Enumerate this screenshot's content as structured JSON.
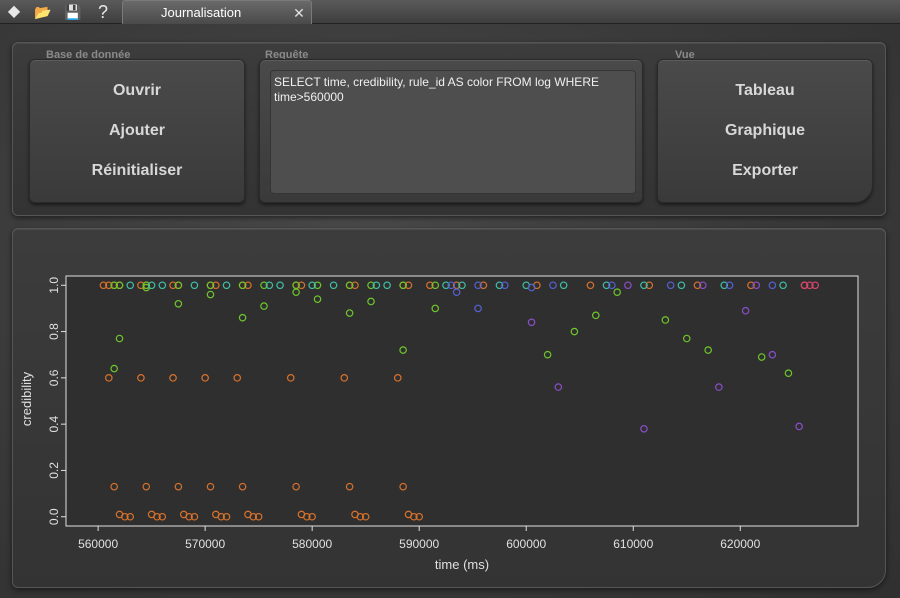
{
  "toolbar": {
    "icons": [
      {
        "name": "diamond-icon",
        "glyph": "◆"
      },
      {
        "name": "open-folder-icon",
        "glyph": "📂"
      },
      {
        "name": "save-icon",
        "glyph": "💾"
      },
      {
        "name": "help-icon",
        "glyph": "?"
      }
    ]
  },
  "tab": {
    "title": "Journalisation",
    "close_glyph": "✕"
  },
  "database": {
    "label": "Base de donnée",
    "open": "Ouvrir",
    "add": "Ajouter",
    "reset": "Réinitialiser"
  },
  "query": {
    "label": "Requête",
    "text": "SELECT time, credibility, rule_id AS color FROM log WHERE time>560000"
  },
  "view": {
    "label": "Vue",
    "table": "Tableau",
    "chart": "Graphique",
    "export": "Exporter"
  },
  "colors": {
    "orange": "#d9722b",
    "green": "#6fc72a",
    "teal": "#3fc0a6",
    "blue": "#5561d6",
    "purple": "#8a4fc9",
    "pink": "#d6456f",
    "axis": "#e0e0e0",
    "plot_bg": "#2f2f2f"
  },
  "chart_data": {
    "type": "scatter",
    "xlabel": "time (ms)",
    "ylabel": "credibility",
    "xlim": [
      557000,
      631000
    ],
    "ylim": [
      -0.04,
      1.04
    ],
    "xticks": [
      560000,
      570000,
      580000,
      590000,
      600000,
      610000,
      620000
    ],
    "xtick_labels": [
      "560000",
      "570000",
      "580000",
      "590000",
      "600000",
      "610000",
      "620000"
    ],
    "yticks": [
      0.0,
      0.2,
      0.4,
      0.6,
      0.8,
      1.0
    ],
    "ytick_labels": [
      "0.0",
      "0.2",
      "0.4",
      "0.6",
      "0.8",
      "1.0"
    ],
    "series": [
      {
        "color": "orange",
        "x": [
          560500,
          561000,
          561500,
          562000,
          564000,
          564500,
          567000,
          567500,
          570500,
          571000,
          573500,
          574000,
          578500,
          579000,
          583500,
          584000,
          588500,
          589000,
          591000,
          593500,
          596000,
          601000,
          606000,
          611500,
          616000,
          621000,
          626000,
          561000,
          564000,
          567000,
          570000,
          573000,
          578000,
          583000,
          588000,
          561500,
          564500,
          567500,
          570500,
          573500,
          578500,
          583500,
          588500,
          562000,
          562500,
          563000,
          565000,
          565500,
          566000,
          568000,
          568500,
          569000,
          571000,
          571500,
          572000,
          574000,
          574500,
          575000,
          579000,
          579500,
          580000,
          584000,
          584500,
          585000,
          589000,
          589500,
          590000
        ],
        "y": [
          1.0,
          1.0,
          1.0,
          1.0,
          1.0,
          1.0,
          1.0,
          1.0,
          1.0,
          1.0,
          1.0,
          1.0,
          1.0,
          1.0,
          1.0,
          1.0,
          1.0,
          1.0,
          1.0,
          1.0,
          1.0,
          1.0,
          1.0,
          1.0,
          1.0,
          1.0,
          1.0,
          0.6,
          0.6,
          0.6,
          0.6,
          0.6,
          0.6,
          0.6,
          0.6,
          0.13,
          0.13,
          0.13,
          0.13,
          0.13,
          0.13,
          0.13,
          0.13,
          0.01,
          0.0,
          0.0,
          0.01,
          0.0,
          0.0,
          0.01,
          0.0,
          0.0,
          0.01,
          0.0,
          0.0,
          0.01,
          0.0,
          0.0,
          0.01,
          0.0,
          0.0,
          0.01,
          0.0,
          0.0,
          0.01,
          0.0,
          0.0
        ]
      },
      {
        "color": "green",
        "x": [
          561500,
          562000,
          564500,
          567500,
          570500,
          573500,
          575500,
          578500,
          580500,
          583500,
          585500,
          588500,
          591500,
          602000,
          604500,
          606500,
          608500,
          613000,
          615000,
          617000,
          622000,
          624500,
          561500,
          562000,
          564500,
          567500,
          570500,
          573500,
          575500,
          578500,
          580500,
          583500,
          585500,
          588500,
          591500
        ],
        "y": [
          0.64,
          0.77,
          0.99,
          0.92,
          0.96,
          0.86,
          0.91,
          0.97,
          0.94,
          0.88,
          0.93,
          0.72,
          0.9,
          0.7,
          0.8,
          0.87,
          0.97,
          0.85,
          0.77,
          0.72,
          0.69,
          0.62,
          1.0,
          1.0,
          1.0,
          1.0,
          1.0,
          1.0,
          1.0,
          1.0,
          1.0,
          1.0,
          1.0,
          1.0,
          1.0
        ]
      },
      {
        "color": "teal",
        "x": [
          563000,
          565000,
          566000,
          569000,
          572000,
          576000,
          577000,
          580000,
          582000,
          586000,
          587000,
          592500,
          594000,
          597500,
          600000,
          603500,
          607500,
          611000,
          614500,
          618500,
          624000
        ],
        "y": [
          1.0,
          1.0,
          1.0,
          1.0,
          1.0,
          1.0,
          1.0,
          1.0,
          1.0,
          1.0,
          1.0,
          1.0,
          1.0,
          1.0,
          1.0,
          1.0,
          1.0,
          1.0,
          1.0,
          1.0,
          1.0
        ]
      },
      {
        "color": "blue",
        "x": [
          593000,
          595500,
          598000,
          602500,
          608000,
          613500,
          619000,
          623000,
          593500,
          595500,
          600500
        ],
        "y": [
          1.0,
          1.0,
          1.0,
          1.0,
          1.0,
          1.0,
          1.0,
          1.0,
          0.97,
          0.9,
          0.99
        ]
      },
      {
        "color": "purple",
        "x": [
          600500,
          603000,
          611000,
          618000,
          620500,
          623000,
          625500,
          609500,
          616500,
          621500
        ],
        "y": [
          0.84,
          0.56,
          0.38,
          0.56,
          0.89,
          0.7,
          0.39,
          1.0,
          1.0,
          1.0
        ]
      },
      {
        "color": "pink",
        "x": [
          626000,
          626500,
          627000
        ],
        "y": [
          1.0,
          1.0,
          1.0
        ]
      }
    ],
    "grid": false
  }
}
